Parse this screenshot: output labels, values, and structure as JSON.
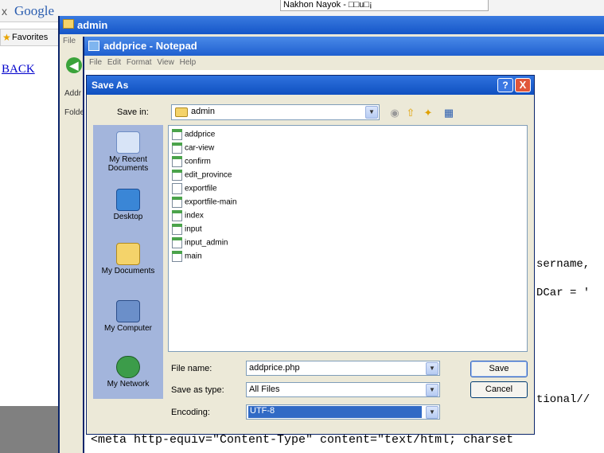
{
  "browser": {
    "close_glyph": "x",
    "google_logo": "Google",
    "tab_text": "Nakhon Nayok - □□u□¡",
    "favorites_label": "Favorites",
    "back_link": "BACK"
  },
  "explorer": {
    "title": "admin",
    "menu_first": "File",
    "address_label": "Addr",
    "folders_label": "Folde"
  },
  "notepad": {
    "title": "addprice - Notepad",
    "menu": "File  Edit  Format  View  Help",
    "visible_code": {
      "line1": "sername,",
      "line2": "DCar = '",
      "line3": "tional//",
      "meta_line": "<meta http-equiv=\"Content-Type\" content=\"text/html; charset"
    }
  },
  "save_dialog": {
    "title": "Save As",
    "help_glyph": "?",
    "close_glyph": "X",
    "save_in_label": "Save in:",
    "save_in_value": "admin",
    "places": [
      {
        "label": "My Recent Documents",
        "icon": "recent-documents-icon"
      },
      {
        "label": "Desktop",
        "icon": "desktop-icon"
      },
      {
        "label": "My Documents",
        "icon": "my-documents-icon"
      },
      {
        "label": "My Computer",
        "icon": "my-computer-icon"
      },
      {
        "label": "My Network",
        "icon": "my-network-icon"
      }
    ],
    "files": [
      {
        "name": "addprice",
        "type": "php"
      },
      {
        "name": "car-view",
        "type": "php"
      },
      {
        "name": "confirm",
        "type": "php"
      },
      {
        "name": "edit_province",
        "type": "php"
      },
      {
        "name": "exportfile",
        "type": "txt"
      },
      {
        "name": "exportfile-main",
        "type": "php"
      },
      {
        "name": "index",
        "type": "php"
      },
      {
        "name": "input",
        "type": "php"
      },
      {
        "name": "input_admin",
        "type": "php"
      },
      {
        "name": "main",
        "type": "php"
      }
    ],
    "file_name_label": "File name:",
    "file_name_value": "addprice.php",
    "save_as_type_label": "Save as type:",
    "save_as_type_value": "All Files",
    "encoding_label": "Encoding:",
    "encoding_value": "UTF-8",
    "save_button": "Save",
    "cancel_button": "Cancel"
  },
  "colors": {
    "xp_title_blue": "#1f5fcf",
    "dialog_face": "#ece9d8",
    "places_bar": "#a3b5dc",
    "selection": "#316ac5"
  }
}
